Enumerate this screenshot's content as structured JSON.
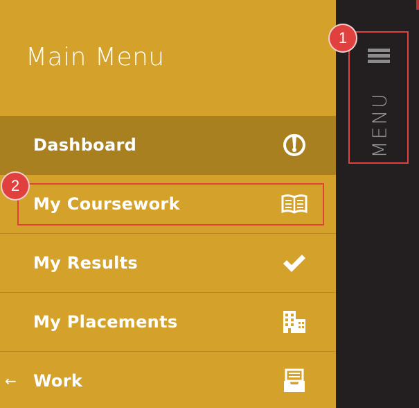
{
  "menu": {
    "title": "Main Menu",
    "items": [
      {
        "label": "Dashboard",
        "icon": "gauge-icon",
        "active": true
      },
      {
        "label": "My Coursework",
        "icon": "book-icon",
        "active": false
      },
      {
        "label": "My Results",
        "icon": "checkmark-icon",
        "active": false
      },
      {
        "label": "My Placements",
        "icon": "buildings-icon",
        "active": false
      },
      {
        "label": "Work",
        "icon": "inbox-tray-icon",
        "active": false,
        "back_arrow": "←"
      }
    ]
  },
  "sidebar": {
    "toggle_label": "MENU",
    "toggle_icon": "hamburger-icon"
  },
  "annotations": {
    "badge_1": "1",
    "badge_2": "2"
  },
  "colors": {
    "panel": "#d4a12b",
    "active_item": "#a88020",
    "sidebar": "#231f20",
    "annotation": "#e0413e"
  }
}
